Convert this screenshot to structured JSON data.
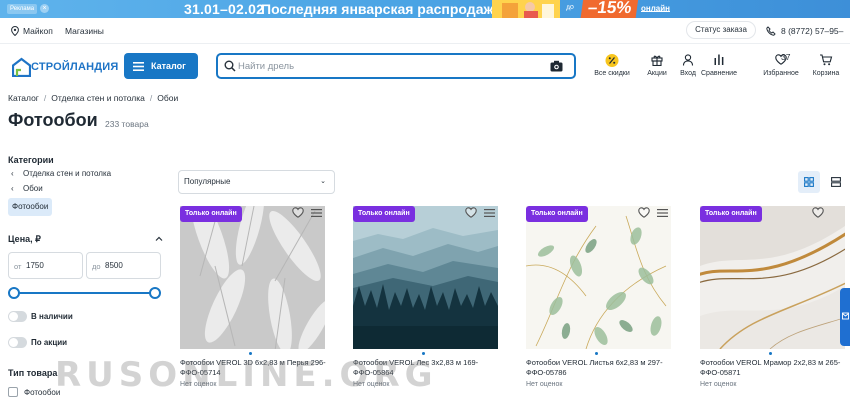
{
  "promo": {
    "ad_label": "Реклама",
    "close": "×",
    "dates": "31.01–02.02",
    "title": "Последняя январская распродажа",
    "discount_prefix": "до",
    "discount": "–15%",
    "link": "онлайн"
  },
  "topbar": {
    "city": "Майкоп",
    "stores": "Магазины",
    "order_status": "Статус заказа",
    "phone": "8 (8772) 57–95–37"
  },
  "header": {
    "logo": "СТРОЙЛАНДИЯ",
    "catalog": "Каталог",
    "search_placeholder": "Найти дрель",
    "actions": [
      {
        "label": "Все скидки",
        "icon": "percent-icon"
      },
      {
        "label": "Акции",
        "icon": "gift-icon"
      },
      {
        "label": "Вход",
        "icon": "user-icon"
      },
      {
        "label": "Сравнение",
        "icon": "compare-icon"
      },
      {
        "label": "Избранное",
        "icon": "heart-icon"
      },
      {
        "label": "Корзина",
        "icon": "cart-icon"
      }
    ]
  },
  "breadcrumbs": [
    "Каталог",
    "Отделка стен и потолка",
    "Обои"
  ],
  "page": {
    "title": "Фотообои",
    "count": "233 товара"
  },
  "sidebar": {
    "categories_title": "Категории",
    "categories": [
      "Отделка стен и потолка",
      "Обои"
    ],
    "selected_category": "Фотообои",
    "price_title": "Цена, ₽",
    "price_from_prefix": "от",
    "price_from": "1750",
    "price_to_prefix": "до",
    "price_to": "8500",
    "toggle_in_stock": "В наличии",
    "toggle_promo": "По акции",
    "type_title": "Тип товара",
    "type_option": "Фотообои"
  },
  "sort": {
    "selected": "Популярные"
  },
  "products": [
    {
      "badge": "Только онлайн",
      "name": "Фотообои VEROL 3D 6x2,83 м Перья 296-ФФО-05714",
      "rating": "Нет оценок"
    },
    {
      "badge": "Только онлайн",
      "name": "Фотообои VEROL Лес 3x2,83 м 169-ФФО-05864",
      "rating": "Нет оценок"
    },
    {
      "badge": "Только онлайн",
      "name": "Фотообои VEROL Листья 6x2,83 м 297-ФФО-05786",
      "rating": "Нет оценок"
    },
    {
      "badge": "Только онлайн",
      "name": "Фотообои VEROL Мрамор 2x2,83 м 265-ФФО-05871",
      "rating": "Нет оценок"
    }
  ],
  "watermark": "RUSONLINE.ORG",
  "colors": {
    "accent": "#1877c5",
    "badge": "#7a2fe0",
    "promo": "#4aa3e4",
    "discount": "#f06a2f"
  }
}
